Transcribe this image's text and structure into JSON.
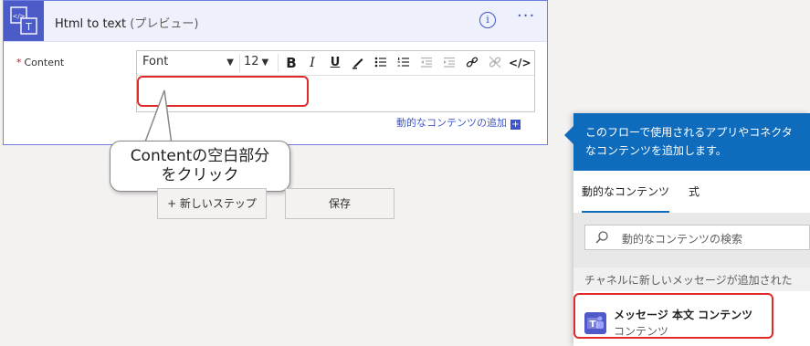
{
  "action": {
    "title": "Html to text",
    "title_suffix": " (プレビュー)",
    "info_icon": "info-icon",
    "more_icon": "more-dots-icon",
    "field": {
      "required_mark": "*",
      "label": "Content"
    },
    "toolbar": {
      "font": "Font",
      "font_size": "12",
      "bold": "B",
      "italic": "I",
      "underline": "U",
      "html_toggle": "</>"
    },
    "add_dynamic_link": "動的なコンテンツの追加",
    "add_dynamic_plus": "+"
  },
  "callout": {
    "line1": "Contentの空白部分",
    "line2": "をクリック"
  },
  "steps": {
    "new_step": "+ 新しいステップ",
    "save": "保存"
  },
  "dynamic_panel": {
    "header_line1": "このフローで使用されるアプリやコネクタ",
    "header_line2": "なコンテンツを追加します。",
    "tabs": [
      "動的なコンテンツ",
      "式"
    ],
    "active_tab": "動的なコンテンツ",
    "search_placeholder": "動的なコンテンツの検索",
    "section_title": "チャネルに新しいメッセージが追加された",
    "items": [
      {
        "title": "メッセージ 本文 コンテンツ",
        "subtitle": "コンテンツ",
        "icon": "teams-icon"
      }
    ]
  },
  "colors": {
    "accent": "#3e55c9",
    "panel_header": "#0f6cbd",
    "highlight": "#e02a2a",
    "action_icon": "#4b5bc8"
  }
}
